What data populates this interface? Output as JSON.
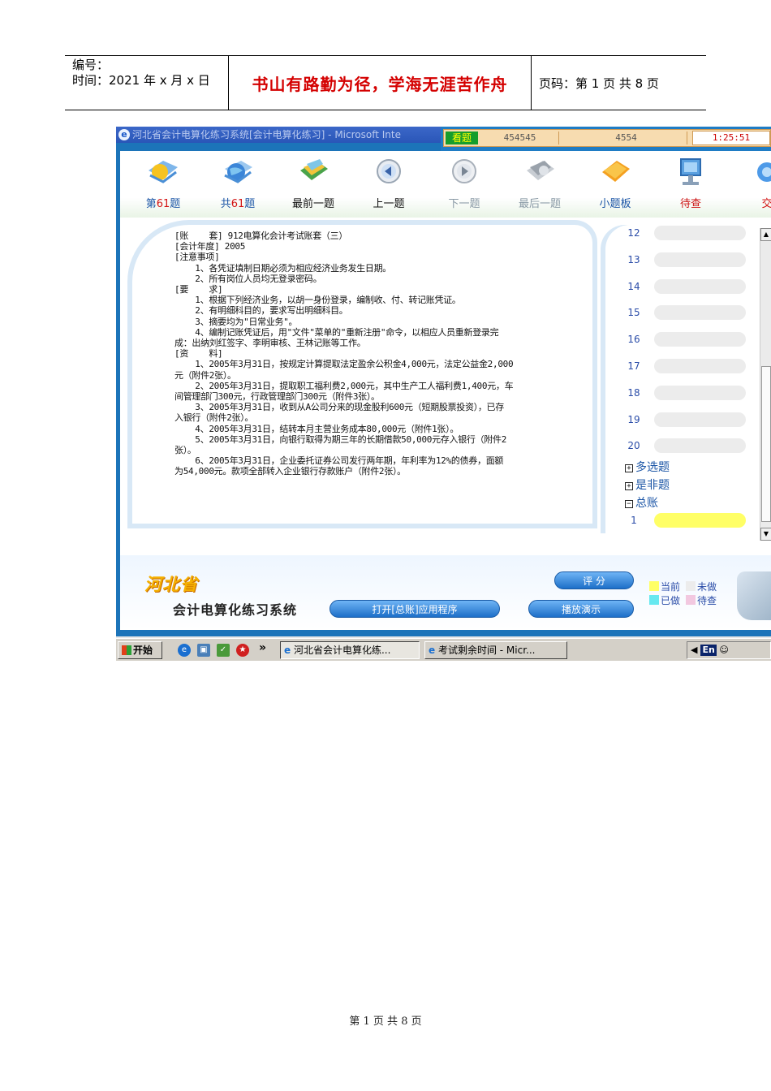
{
  "header": {
    "number_label": "编号：",
    "date_label": "时间：2021 年 x 月 x 日",
    "motto": "书山有路勤为径，学海无涯苦作舟",
    "page_info": "页码：第 1 页  共 8 页"
  },
  "window": {
    "title": "河北省会计电算化练习系统[会计电算化练习] - Microsoft Inte"
  },
  "timer_bar": {
    "button": "看题",
    "field1": "454545",
    "field2": "4554",
    "time": "1:25:51"
  },
  "toolbar": {
    "items": [
      {
        "icon": "question-icon",
        "label_prefix": "第",
        "label_num": "61",
        "label_suffix": "题"
      },
      {
        "icon": "globe-icon",
        "label_prefix": "共",
        "label_num": "61",
        "label_suffix": "题"
      },
      {
        "icon": "first-icon",
        "label": "最前一题"
      },
      {
        "icon": "prev-icon",
        "label": "上一题"
      },
      {
        "icon": "next-icon",
        "label": "下一题"
      },
      {
        "icon": "last-icon",
        "label": "最后一题"
      },
      {
        "icon": "note-board-icon",
        "label": "小题板"
      },
      {
        "icon": "monitor-icon",
        "label": "待查"
      },
      {
        "icon": "submit-icon",
        "label": "交"
      }
    ]
  },
  "question": {
    "lines": [
      "[账    套] 912电算化会计考试账套（三）",
      "[会计年度] 2005",
      "[注意事项]",
      "    1、各凭证填制日期必须为相应经济业务发生日期。",
      "    2、所有岗位人员均无登录密码。",
      "[要    求]",
      "    1、根据下列经济业务，以胡一身份登录，编制收、付、转记账凭证。",
      "    2、有明细科目的，要求写出明细科目。",
      "    3、摘要均为\"日常业务\"。",
      "    4、编制记账凭证后，用\"文件\"菜单的\"重新注册\"命令，以相应人员重新登录完",
      "成：出纳刘红签字、李明审核、王林记账等工作。",
      "[资    料]",
      "    1、2005年3月31日，按规定计算提取法定盈余公积金4,000元，法定公益金2,000",
      "元（附件2张）。",
      "    2、2005年3月31日，提取职工福利费2,000元，其中生产工人福利费1,400元，车",
      "间管理部门300元，行政管理部门300元（附件3张）。",
      "    3、2005年3月31日，收到从A公司分来的现金股利600元（短期股票投资），已存",
      "入银行（附件2张）。",
      "    4、2005年3月31日，结转本月主营业务成本80,000元（附件1张）。",
      "    5、2005年3月31日，向银行取得为期三年的长期借款50,000元存入银行（附件2",
      "张）。",
      "    6、2005年3月31日，企业委托证券公司发行两年期，年利率为12%的债券，面额",
      "为54,000元。款项全部转入企业银行存款账户（附件2张）。"
    ]
  },
  "question_list": {
    "numbers": [
      "12",
      "13",
      "14",
      "15",
      "16",
      "17",
      "18",
      "19",
      "20"
    ],
    "groups": [
      {
        "symbol": "+",
        "label": "多选题"
      },
      {
        "symbol": "+",
        "label": "是非题"
      },
      {
        "symbol": "−",
        "label": "总账"
      }
    ],
    "current_number": "1"
  },
  "bottom": {
    "logo_top": "河北省",
    "logo_bottom": "会计电算化练习系统",
    "open_button": "打开[总账]应用程序",
    "score_button": "评  分",
    "play_button": "播放演示",
    "legend": {
      "current": "当前",
      "not_done": "未做",
      "done": "已做",
      "pending": "待查"
    }
  },
  "colors": {
    "current": "#ffff66",
    "not_done": "#ececec",
    "done": "#66e8f0",
    "pending": "#f2c8e0"
  },
  "taskbar": {
    "start": "开始",
    "chevron": "»",
    "task1": "河北省会计电算化练...",
    "task2": "考试剩余时间 - Micr...",
    "tray_lang": "En"
  },
  "footer": {
    "text": "第  1  页  共  8  页"
  }
}
